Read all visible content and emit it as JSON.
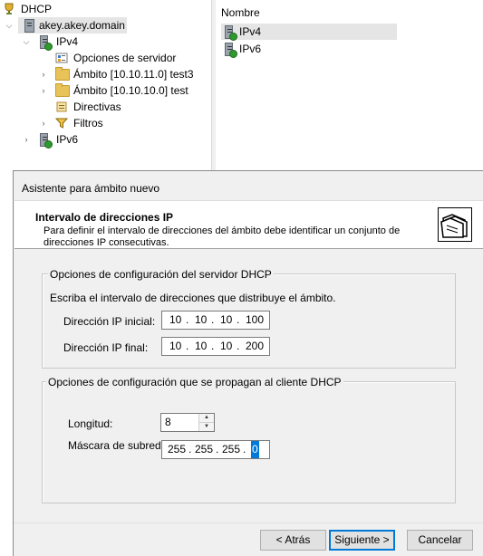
{
  "tree": {
    "root_label": "DHCP",
    "server_label": "akey.akey.domain",
    "ipv4_label": "IPv4",
    "children": [
      "Opciones de servidor",
      "Ámbito [10.10.11.0] test3",
      "Ámbito [10.10.10.0] test",
      "Directivas",
      "Filtros"
    ],
    "ipv6_label": "IPv6"
  },
  "list": {
    "column_header": "Nombre",
    "items": [
      "IPv4",
      "IPv6"
    ]
  },
  "wizard": {
    "title": "Asistente para ámbito nuevo",
    "heading": "Intervalo de direcciones IP",
    "description": "Para definir el intervalo de direcciones del ámbito debe identificar un conjunto de direcciones IP consecutivas.",
    "group1": {
      "title": "Opciones de configuración del servidor DHCP",
      "instruction": "Escriba el intervalo de direcciones que distribuye el ámbito.",
      "start_label": "Dirección IP inicial:",
      "start_ip": [
        "10",
        "10",
        "10",
        "100"
      ],
      "end_label": "Dirección IP final:",
      "end_ip": [
        "10",
        "10",
        "10",
        "200"
      ]
    },
    "group2": {
      "title": "Opciones de configuración que se propagan al cliente DHCP",
      "length_label": "Longitud:",
      "length_value": "8",
      "mask_label": "Máscara de subred:",
      "mask": [
        "255",
        "255",
        "255",
        "0"
      ]
    },
    "buttons": {
      "back": "< Atrás",
      "next": "Siguiente >",
      "cancel": "Cancelar"
    }
  }
}
